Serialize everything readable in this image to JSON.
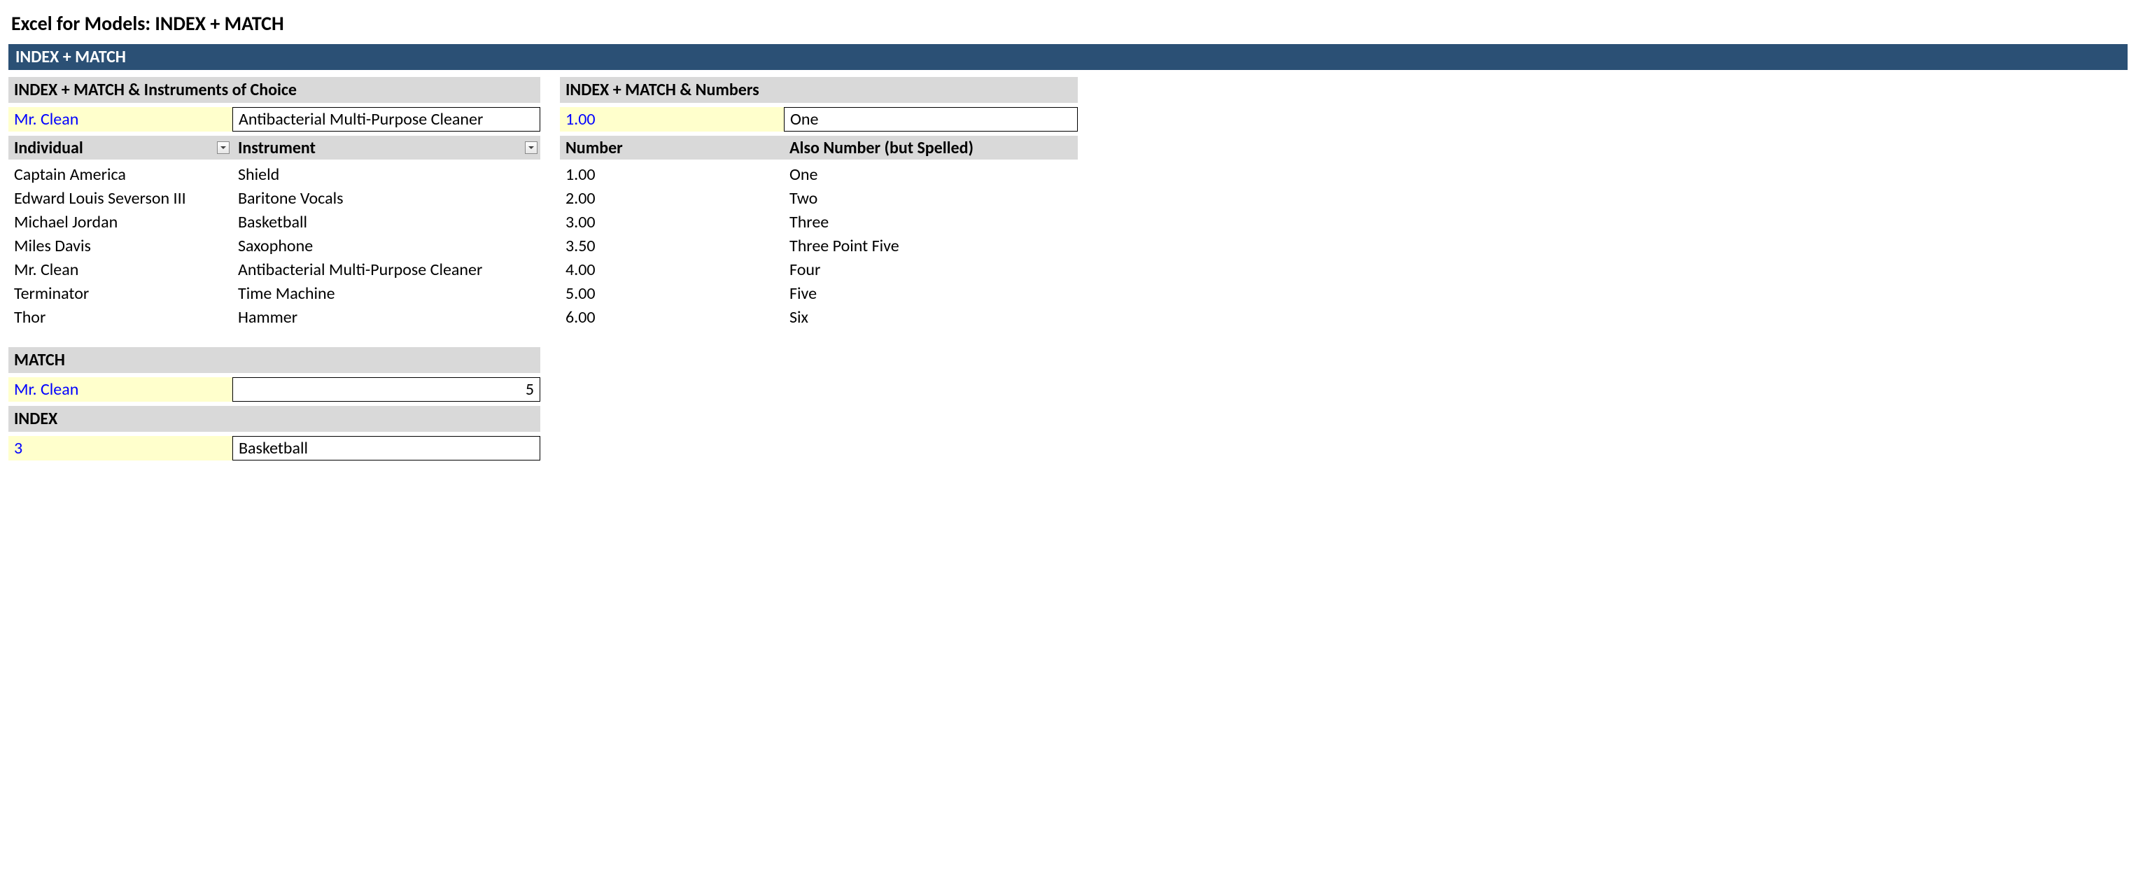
{
  "page_title": "Excel for Models: INDEX + MATCH",
  "banner": "INDEX + MATCH",
  "left": {
    "section1_title": "INDEX + MATCH & Instruments of Choice",
    "lookup_input": "Mr. Clean",
    "lookup_result": "Antibacterial Multi-Purpose Cleaner",
    "col1_header": "Individual",
    "col2_header": "Instrument",
    "rows": [
      {
        "individual": "Captain America",
        "instrument": "Shield"
      },
      {
        "individual": "Edward Louis Severson III",
        "instrument": "Baritone Vocals"
      },
      {
        "individual": "Michael Jordan",
        "instrument": "Basketball"
      },
      {
        "individual": "Miles Davis",
        "instrument": "Saxophone"
      },
      {
        "individual": "Mr. Clean",
        "instrument": "Antibacterial Multi-Purpose Cleaner"
      },
      {
        "individual": "Terminator",
        "instrument": "Time Machine"
      },
      {
        "individual": "Thor",
        "instrument": "Hammer"
      }
    ],
    "match_title": "MATCH",
    "match_input": "Mr. Clean",
    "match_result": "5",
    "index_title": "INDEX",
    "index_input": "3",
    "index_result": "Basketball"
  },
  "right": {
    "section_title": "INDEX + MATCH & Numbers",
    "lookup_input": "1.00",
    "lookup_result": "One",
    "col1_header": "Number",
    "col2_header": "Also Number (but Spelled)",
    "rows": [
      {
        "num": "1.00",
        "word": "One"
      },
      {
        "num": "2.00",
        "word": "Two"
      },
      {
        "num": "3.00",
        "word": "Three"
      },
      {
        "num": "3.50",
        "word": "Three Point Five"
      },
      {
        "num": "4.00",
        "word": "Four"
      },
      {
        "num": "5.00",
        "word": "Five"
      },
      {
        "num": "6.00",
        "word": "Six"
      }
    ]
  }
}
